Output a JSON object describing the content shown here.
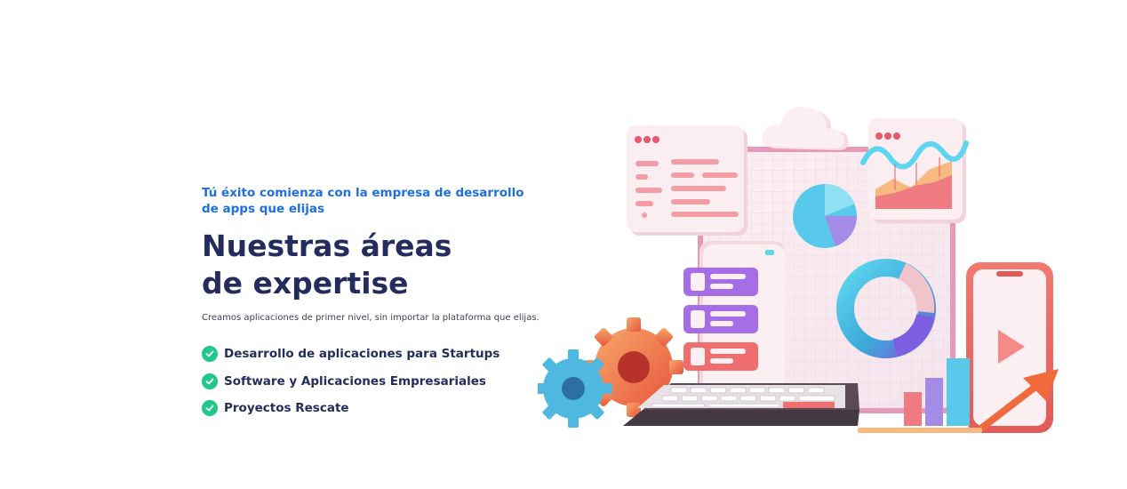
{
  "hero": {
    "eyebrow": "Tú éxito comienza con la empresa de desarrollo de apps que elijas",
    "title": "Nuestras áreas de expertise",
    "subtitle": "Creamos aplicaciones de primer nivel, sin importar la plataforma que elijas.",
    "features": [
      {
        "label": "Desarrollo de aplicaciones para Startups",
        "icon": "check-circle-icon"
      },
      {
        "label": "Software y Aplicaciones Empresariales",
        "icon": "check-circle-icon"
      },
      {
        "label": "Proyectos Rescate",
        "icon": "check-circle-icon"
      }
    ]
  },
  "colors": {
    "eyebrow": "#1f6fe0",
    "heading": "#232c5c",
    "check": "#22c78a"
  }
}
